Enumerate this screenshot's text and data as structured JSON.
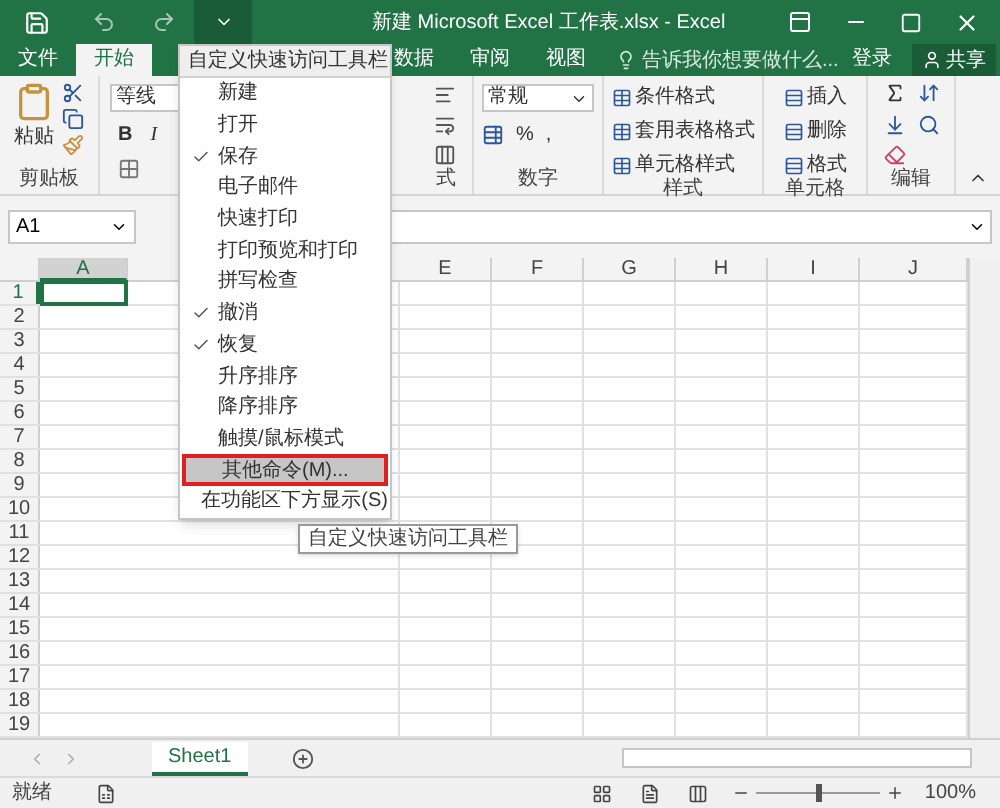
{
  "window": {
    "title": "新建 Microsoft Excel 工作表.xlsx - Excel"
  },
  "tabs": [
    {
      "label": "文件",
      "selected": false
    },
    {
      "label": "开始",
      "selected": true
    },
    {
      "label": "数据",
      "selected": false
    },
    {
      "label": "审阅",
      "selected": false
    },
    {
      "label": "视图",
      "selected": false
    }
  ],
  "tell_me": {
    "placeholder": "告诉我你想要做什么..."
  },
  "account": {
    "sign_in": "登录",
    "share": "共享"
  },
  "ribbon": {
    "clipboard": {
      "paste": "粘贴",
      "label": "剪贴板"
    },
    "font": {
      "name": "等线",
      "bold": "B",
      "italic": "I"
    },
    "alignment": {
      "label": "式"
    },
    "number": {
      "format": "常规",
      "percent": "%",
      "comma": ",",
      "label": "数字"
    },
    "styles": {
      "items": [
        "条件格式",
        "套用表格格式",
        "单元格样式"
      ],
      "label": "样式"
    },
    "cells": {
      "items": [
        "插入",
        "删除",
        "格式"
      ],
      "label": "单元格"
    },
    "editing": {
      "label": "编辑"
    }
  },
  "name_box": "A1",
  "columns": [
    {
      "label": "A",
      "selected": true
    },
    {
      "label": "E",
      "selected": false
    },
    {
      "label": "F",
      "selected": false
    },
    {
      "label": "G",
      "selected": false
    },
    {
      "label": "H",
      "selected": false
    },
    {
      "label": "I",
      "selected": false
    },
    {
      "label": "J",
      "selected": false
    }
  ],
  "rows": [
    {
      "label": "1",
      "selected": true
    },
    {
      "label": "2",
      "selected": false
    },
    {
      "label": "3",
      "selected": false
    },
    {
      "label": "4",
      "selected": false
    },
    {
      "label": "5",
      "selected": false
    },
    {
      "label": "6",
      "selected": false
    },
    {
      "label": "7",
      "selected": false
    },
    {
      "label": "8",
      "selected": false
    },
    {
      "label": "9",
      "selected": false
    },
    {
      "label": "10",
      "selected": false
    },
    {
      "label": "11",
      "selected": false
    },
    {
      "label": "12",
      "selected": false
    },
    {
      "label": "13",
      "selected": false
    },
    {
      "label": "14",
      "selected": false
    },
    {
      "label": "15",
      "selected": false
    },
    {
      "label": "16",
      "selected": false
    },
    {
      "label": "17",
      "selected": false
    },
    {
      "label": "18",
      "selected": false
    },
    {
      "label": "19",
      "selected": false
    }
  ],
  "sheets": [
    {
      "label": "Sheet1",
      "selected": true
    }
  ],
  "status_bar": {
    "text": "就绪",
    "zoom": "100%",
    "level": 0.5
  },
  "menu": {
    "title": "自定义快速访问工具栏",
    "items": [
      {
        "label": "新建",
        "checked": false,
        "selected": false,
        "outlined": false
      },
      {
        "label": "打开",
        "checked": false,
        "selected": false,
        "outlined": false
      },
      {
        "label": "保存",
        "checked": true,
        "selected": false,
        "outlined": false
      },
      {
        "label": "电子邮件",
        "checked": false,
        "selected": false,
        "outlined": false
      },
      {
        "label": "快速打印",
        "checked": false,
        "selected": false,
        "outlined": false
      },
      {
        "label": "打印预览和打印",
        "checked": false,
        "selected": false,
        "outlined": false
      },
      {
        "label": "拼写检查",
        "checked": false,
        "selected": false,
        "outlined": false
      },
      {
        "label": "撤消",
        "checked": true,
        "selected": false,
        "outlined": false
      },
      {
        "label": "恢复",
        "checked": true,
        "selected": false,
        "outlined": false
      },
      {
        "label": "升序排序",
        "checked": false,
        "selected": false,
        "outlined": false
      },
      {
        "label": "降序排序",
        "checked": false,
        "selected": false,
        "outlined": false
      },
      {
        "label": "触摸/鼠标模式",
        "checked": false,
        "selected": false,
        "outlined": false
      },
      {
        "label": "其他命令(M)...",
        "checked": false,
        "selected": true,
        "outlined": true
      },
      {
        "label": "在功能区下方显示(S)",
        "checked": false,
        "selected": false,
        "outlined": false
      }
    ]
  },
  "tooltip": "自定义快速访问工具栏"
}
